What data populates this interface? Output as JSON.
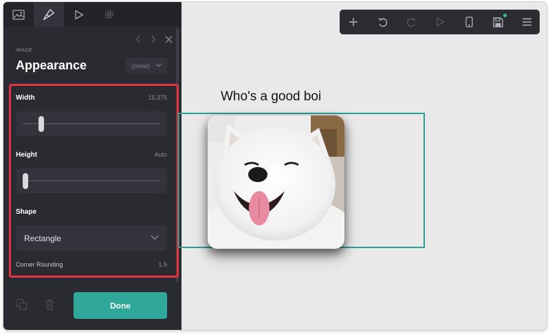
{
  "tabs": [
    {
      "icon": "image-icon"
    },
    {
      "icon": "brush-icon"
    },
    {
      "icon": "play-icon"
    },
    {
      "icon": "gear-icon"
    }
  ],
  "panel": {
    "section_label": "IMAGE",
    "title": "Appearance",
    "style_select_value": "(none)",
    "width_label": "Width",
    "width_value": "15.375",
    "width_fraction": 0.12,
    "height_label": "Height",
    "height_value": "Auto",
    "height_fraction": 0.0,
    "shape_label": "Shape",
    "shape_value": "Rectangle",
    "corner_label": "Corner Rounding",
    "corner_value": "1.5",
    "done_label": "Done"
  },
  "canvas": {
    "caption": "Who's a good boi"
  },
  "toolbar": {
    "icons": [
      "plus-icon",
      "undo-icon",
      "redo-icon",
      "play-icon",
      "phone-icon",
      "save-icon",
      "menu-icon"
    ]
  },
  "colors": {
    "accent": "#2fa79a",
    "highlight": "#e5343f",
    "panel_bg": "#2a2b31",
    "canvas_bg": "#e9e9e9"
  }
}
